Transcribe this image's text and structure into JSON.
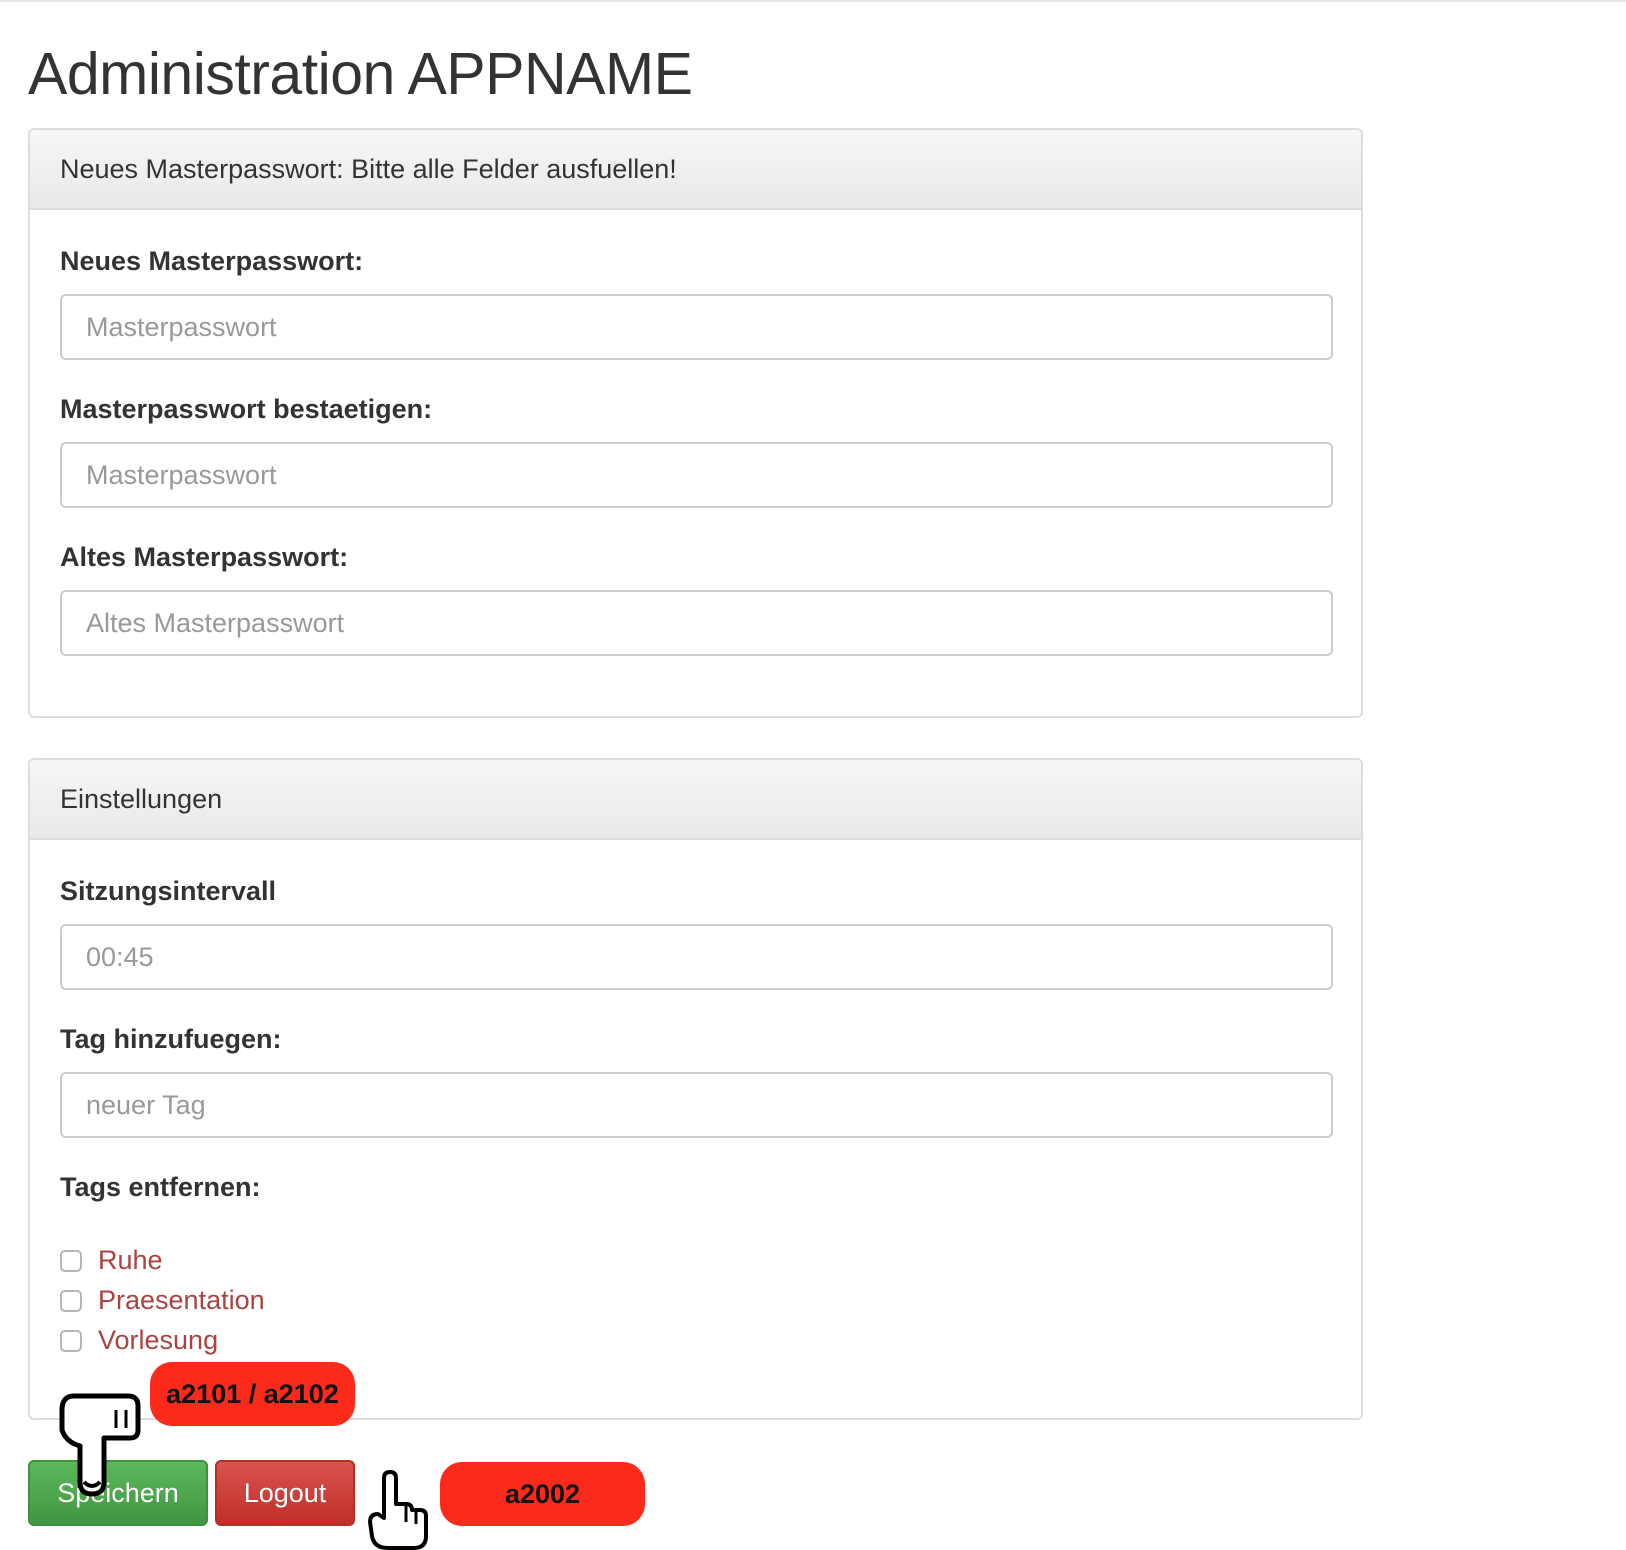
{
  "page": {
    "title": "Administration APPNAME"
  },
  "password_panel": {
    "heading": "Neues Masterpasswort: Bitte alle Felder ausfuellen!",
    "fields": [
      {
        "label": "Neues Masterpasswort:",
        "placeholder": "Masterpasswort",
        "value": ""
      },
      {
        "label": "Masterpasswort bestaetigen:",
        "placeholder": "Masterpasswort",
        "value": ""
      },
      {
        "label": "Altes Masterpasswort:",
        "placeholder": "Altes Masterpasswort",
        "value": ""
      }
    ]
  },
  "settings_panel": {
    "heading": "Einstellungen",
    "session_interval": {
      "label": "Sitzungsintervall",
      "placeholder": "00:45"
    },
    "add_tag": {
      "label": "Tag hinzufuegen:",
      "placeholder": "neuer Tag"
    },
    "remove_tags": {
      "label": "Tags entfernen:",
      "tags": [
        {
          "name": "Ruhe",
          "checked": false
        },
        {
          "name": "Praesentation",
          "checked": false
        },
        {
          "name": "Vorlesung",
          "checked": false
        }
      ]
    }
  },
  "buttons": {
    "save": "Speichern",
    "logout": "Logout"
  },
  "annotations": {
    "save_badge": "a2101 / a2102",
    "logout_badge": "a2002",
    "badge_color": "#fb2a1b"
  },
  "colors": {
    "save_button": "#5cb85c",
    "logout_button": "#d9534f",
    "tag_label": "#a94442"
  }
}
